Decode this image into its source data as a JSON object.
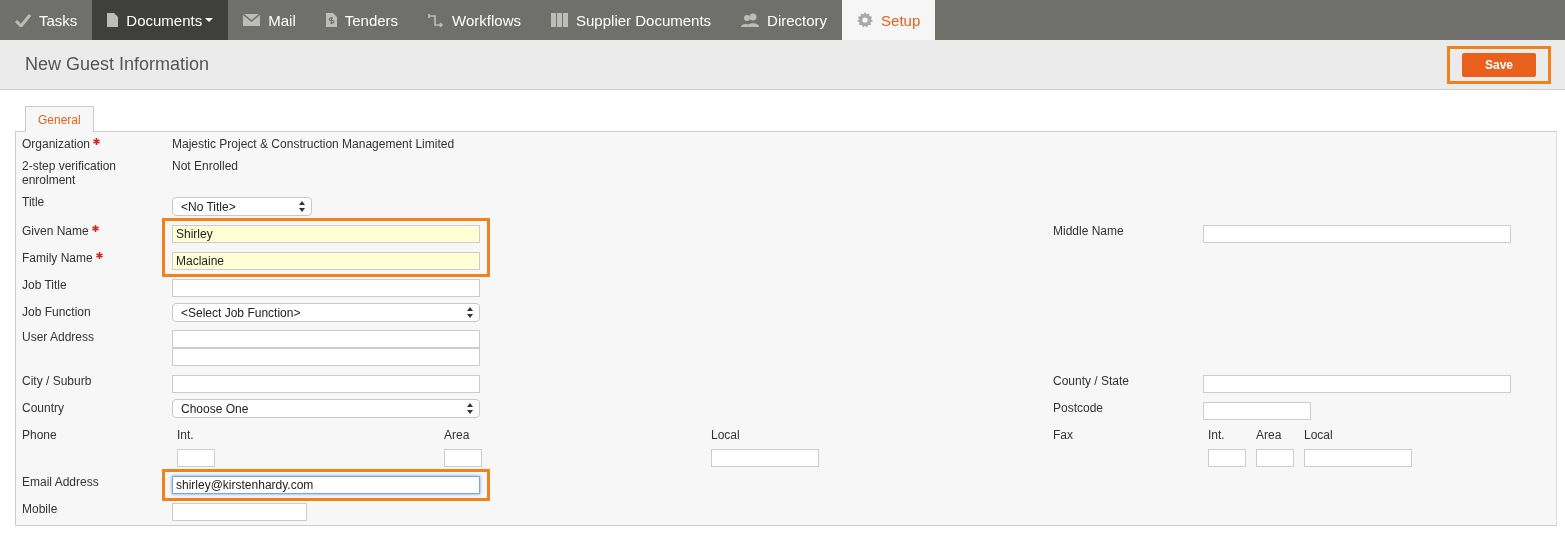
{
  "nav": [
    {
      "label": "Tasks",
      "kind": "tick",
      "selected": false,
      "hovered": false,
      "dropdown": false
    },
    {
      "label": "Documents",
      "kind": "document",
      "selected": false,
      "hovered": true,
      "dropdown": true
    },
    {
      "label": "Mail",
      "kind": "envelope",
      "selected": false,
      "hovered": false,
      "dropdown": false
    },
    {
      "label": "Tenders",
      "kind": "dollar",
      "selected": false,
      "hovered": false,
      "dropdown": false
    },
    {
      "label": "Workflows",
      "kind": "workflow",
      "selected": false,
      "hovered": false,
      "dropdown": false
    },
    {
      "label": "Supplier Documents",
      "kind": "binders",
      "selected": false,
      "hovered": false,
      "dropdown": false
    },
    {
      "label": "Directory",
      "kind": "people",
      "selected": false,
      "hovered": false,
      "dropdown": false
    },
    {
      "label": "Setup",
      "kind": "gear",
      "selected": true,
      "hovered": false,
      "dropdown": false
    }
  ],
  "page_title": "New Guest Information",
  "save_button": {
    "label": "Save",
    "highlighted": true
  },
  "tabs": [
    {
      "label": "General",
      "selected": true
    }
  ],
  "form": {
    "rows": [
      {
        "left": {
          "label": "Organization",
          "required": true,
          "kind": "static",
          "value": "Majestic Project & Construction Management Limited"
        }
      },
      {
        "left": {
          "label": "2-step verification enrolment",
          "required": false,
          "kind": "static",
          "value": "Not Enrolled"
        }
      },
      {
        "left": {
          "label": "Title",
          "required": false,
          "kind": "short-select",
          "value": "<No Title>"
        }
      },
      {
        "left": {
          "label": "Given Name",
          "required": true,
          "kind": "input",
          "value": "Shirley",
          "autofilled": true,
          "focused": false,
          "highlighted": true
        },
        "right": {
          "label": "Middle Name",
          "required": false,
          "kind": "input"
        }
      },
      {
        "left": {
          "label": "Family Name",
          "required": true,
          "kind": "input",
          "value": "Maclaine",
          "autofilled": true,
          "focused": false,
          "highlighted": true
        }
      },
      {
        "left": {
          "label": "Job Title",
          "required": false,
          "kind": "input"
        }
      },
      {
        "left": {
          "label": "Job Function",
          "required": false,
          "kind": "select",
          "value": "<Select Job Function>"
        }
      },
      {
        "left": {
          "label": "User Address",
          "required": false,
          "kind": "address"
        }
      },
      {
        "left": {
          "label": "City / Suburb",
          "required": false,
          "kind": "input"
        },
        "right": {
          "label": "County / State",
          "required": false,
          "kind": "input"
        }
      },
      {
        "left": {
          "label": "Country",
          "required": false,
          "kind": "select",
          "value": "Choose One"
        },
        "right": {
          "label": "Postcode",
          "required": false,
          "kind": "short-input"
        }
      },
      {
        "left": {
          "label": "Phone",
          "required": false,
          "kind": "phone",
          "parts": [
            {
              "label": "Int.",
              "kind": "short"
            },
            {
              "label": "Area",
              "kind": "short"
            },
            {
              "label": "Local",
              "kind": "long"
            }
          ]
        },
        "right": {
          "label": "Fax",
          "required": false,
          "kind": "phone",
          "parts": [
            {
              "label": "Int.",
              "kind": "short"
            },
            {
              "label": "Area",
              "kind": "short"
            },
            {
              "label": "Local",
              "kind": "long"
            }
          ]
        }
      },
      {
        "left": {
          "label": "Email Address",
          "required": false,
          "kind": "input",
          "value": "shirley@kirstenhardy.com",
          "autofilled": false,
          "focused": true,
          "highlighted": true
        }
      },
      {
        "left": {
          "label": "Mobile",
          "required": false,
          "kind": "mobile-input"
        }
      }
    ]
  }
}
